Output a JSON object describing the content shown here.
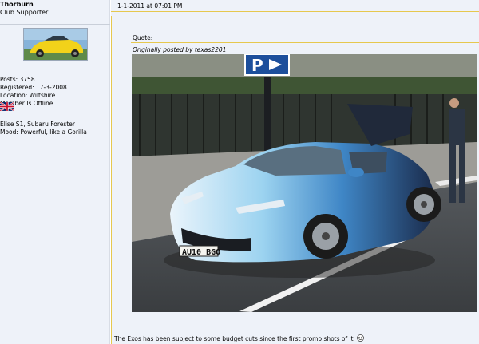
{
  "user": {
    "name": "Thorburn",
    "title": "Club Supporter",
    "posts": "Posts: 3758",
    "registered": "Registered: 17-3-2008",
    "location": "Location: Wiltshire",
    "status": "Member Is Offline",
    "cars": "Elise S1, Subaru Forester",
    "mood": "Mood: Powerful, like a Gorilla"
  },
  "post": {
    "date": "1-1-2011 at 07:01 PM",
    "quote_label": "Quote:",
    "quote_author_prefix": "Originally posted by",
    "quote_author": "texas2201",
    "body_text": "The Exos has been subject to some budget cuts since the first promo shots of it",
    "photo_plate": "AU10 BGO"
  },
  "colors": {
    "panel_bg": "#eef2f9",
    "divider_gold": "#e6c84e"
  },
  "icons": {
    "flag": "union-jack-flag-icon",
    "smiley": "smiley-icon"
  }
}
